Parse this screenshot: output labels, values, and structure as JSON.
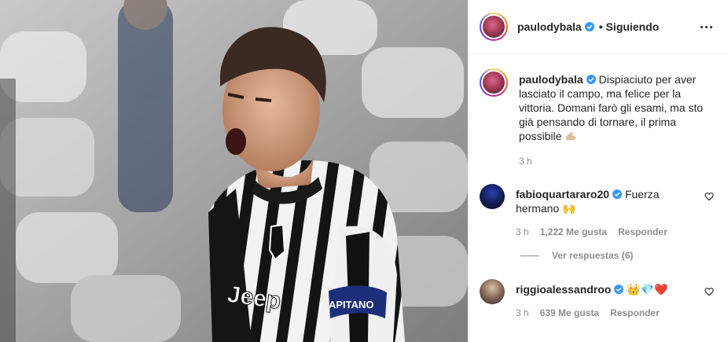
{
  "post": {
    "author": "paulodybala",
    "follow_label": "Siguiendo",
    "caption_text": "Dispiaciuto per aver lasciato il campo, ma felice per la vittoria. Domani farò gli esami, ma sto già pensando di tornare, il prima possibile",
    "caption_time": "3 h",
    "shirt_sponsor": "Jeep",
    "armband_text": "APITANO"
  },
  "comments": [
    {
      "user": "fabioquartararo20",
      "text": "Fuerza hermano 🙌",
      "time": "3 h",
      "likes": "1,222 Me gusta",
      "reply_label": "Responder",
      "view_replies": "Ver respuestas (6)"
    },
    {
      "user": "riggioalessandroo",
      "text": "👑💎❤️",
      "time": "3 h",
      "likes": "639 Me gusta",
      "reply_label": "Responder"
    }
  ],
  "icons": {
    "verified": "verified-badge-icon",
    "more": "more-options-icon",
    "like": "heart-icon",
    "muscle": "flexed-biceps-emoji"
  },
  "colors": {
    "verified_blue": "#3897f0",
    "muted_text": "#8e8e8e",
    "border": "#efefef"
  }
}
